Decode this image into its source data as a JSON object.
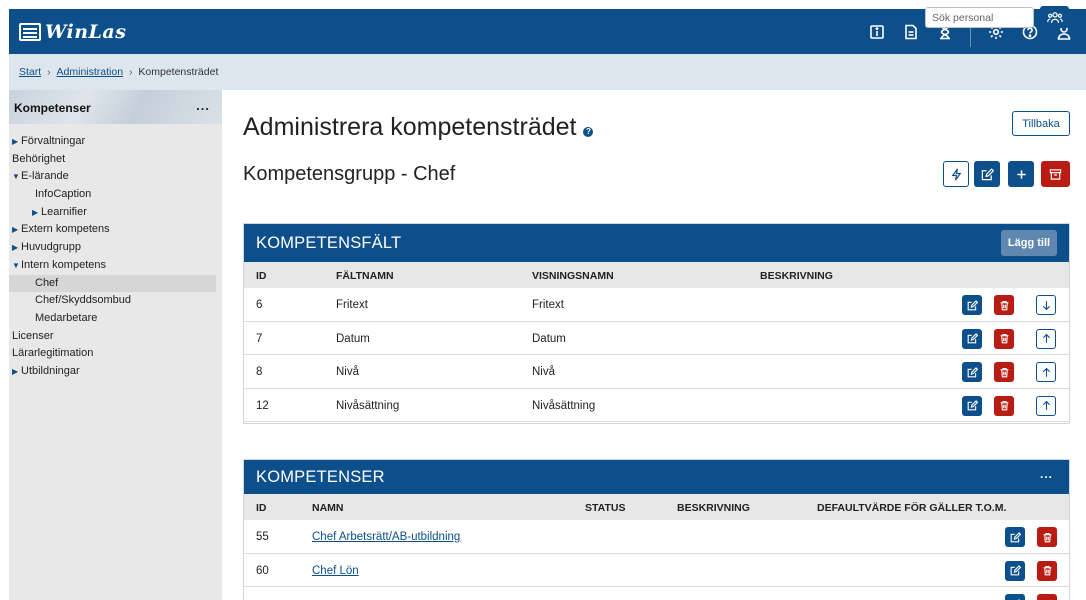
{
  "header": {
    "logo_text": "WinLas",
    "brand_color": "#0d4f8b",
    "icons": [
      "info-icon",
      "document-icon",
      "hourglass-icon",
      "settings-icon",
      "help-icon",
      "user-icon"
    ]
  },
  "breadcrumb": {
    "items": [
      "Start",
      "Administration",
      "Kompetensträdet"
    ],
    "search_placeholder": "Sök personal"
  },
  "sidebar": {
    "title": "Kompetenser",
    "menu_label": "...",
    "items": [
      {
        "label": "Förvaltningar",
        "caret": "▶"
      },
      {
        "label": "Behörighet",
        "caret": ""
      },
      {
        "label": "E-lärande",
        "caret": "▼"
      },
      {
        "label": "InfoCaption",
        "caret": ""
      },
      {
        "label": "Learnifier",
        "caret": "▶"
      },
      {
        "label": "Extern kompetens",
        "caret": "▶"
      },
      {
        "label": "Huvudgrupp",
        "caret": "▶"
      },
      {
        "label": "Intern kompetens",
        "caret": "▼"
      },
      {
        "label": "Chef",
        "caret": ""
      },
      {
        "label": "Chef/Skyddsombud",
        "caret": ""
      },
      {
        "label": "Medarbetare",
        "caret": ""
      },
      {
        "label": "Licenser",
        "caret": ""
      },
      {
        "label": "Lärarlegitimation",
        "caret": ""
      },
      {
        "label": "Utbildningar",
        "caret": "▶"
      }
    ]
  },
  "main": {
    "title": "Administrera kompetensträdet",
    "help_label": "?",
    "back_label": "Tillbaka",
    "group_title": "Kompetensgrupp - Chef"
  },
  "fields_panel": {
    "title": "KOMPETENSFÄLT",
    "add_label": "Lägg till",
    "columns": [
      "ID",
      "FÄLTNAMN",
      "VISNINGSNAMN",
      "BESKRIVNING"
    ],
    "rows": [
      {
        "id": "6",
        "name": "Fritext",
        "display": "Fritext",
        "desc": ""
      },
      {
        "id": "7",
        "name": "Datum",
        "display": "Datum",
        "desc": ""
      },
      {
        "id": "8",
        "name": "Nivå",
        "display": "Nivå",
        "desc": ""
      },
      {
        "id": "12",
        "name": "Nivåsättning",
        "display": "Nivåsättning",
        "desc": ""
      }
    ]
  },
  "competences_panel": {
    "title": "KOMPETENSER",
    "menu_label": "...",
    "columns": [
      "ID",
      "NAMN",
      "STATUS",
      "BESKRIVNING",
      "DEFAULTVÄRDE FÖR GÄLLER T.O.M."
    ],
    "rows": [
      {
        "id": "55",
        "name": "Chef Arbetsrätt/AB-utbildning"
      },
      {
        "id": "60",
        "name": "Chef Lön"
      }
    ]
  }
}
